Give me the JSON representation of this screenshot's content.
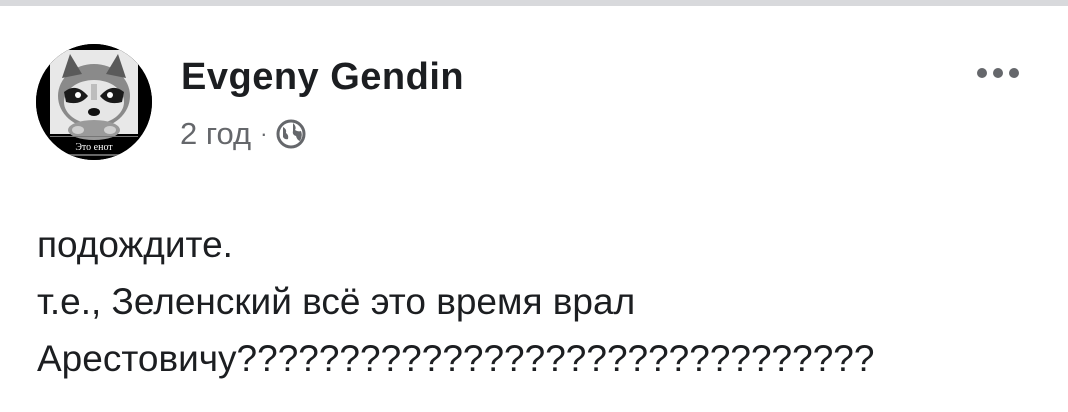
{
  "post": {
    "author": "Evgeny Gendin",
    "timestamp": "2 год",
    "separator": "·",
    "privacy_icon": "globe-icon",
    "more_icon": "more-options-icon",
    "avatar_caption": "Это енот",
    "text_lines": [
      "подождите.",
      "т.е., Зеленский всё это время врал",
      "Арестовичу???????????????????????????????"
    ]
  },
  "colors": {
    "text": "#1c1e21",
    "secondary": "#65676b",
    "top_strip": "#d8d9dc"
  }
}
